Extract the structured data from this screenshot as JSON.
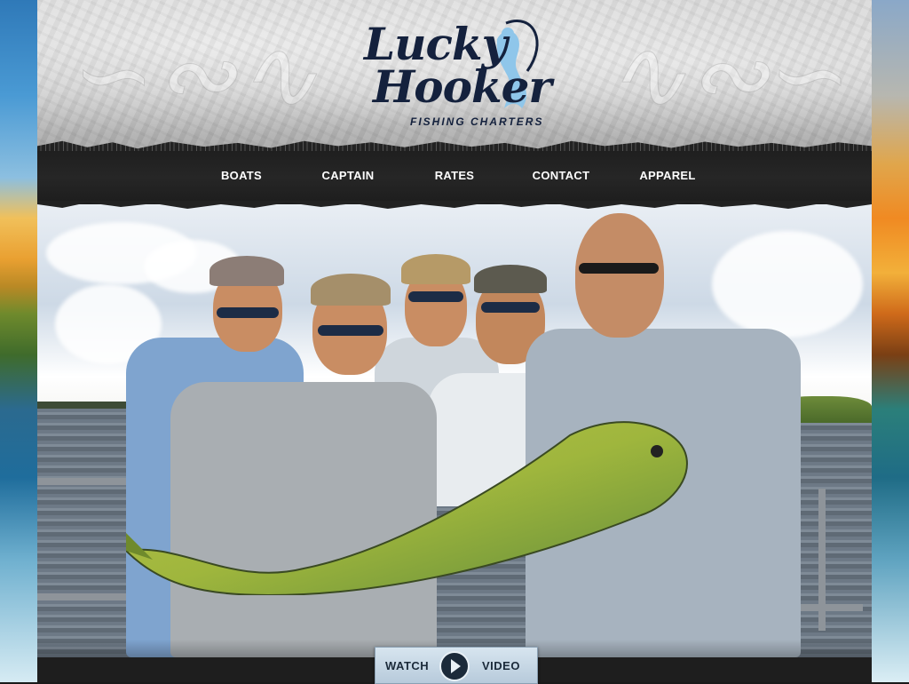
{
  "logo": {
    "line1": "Lucky",
    "line2": "Hooker",
    "subtitle": "FISHING CHARTERS"
  },
  "nav": {
    "items": [
      {
        "label": "BOATS"
      },
      {
        "label": "CAPTAIN"
      },
      {
        "label": "RATES"
      },
      {
        "label": "CONTACT"
      },
      {
        "label": "APPAREL"
      }
    ]
  },
  "hero": {
    "image": "photo-of-five-anglers-holding-mahi-mahi-on-boat"
  },
  "watch_video": {
    "left_label": "WATCH",
    "right_label": "VIDEO",
    "icon": "play-icon"
  },
  "colors": {
    "logo_navy": "#14213d",
    "logo_mermaid": "#8fc6ea",
    "nav_bg": "#1f1f1f",
    "nav_text": "#ffffff",
    "video_button_bg": "#c8d9e6"
  }
}
